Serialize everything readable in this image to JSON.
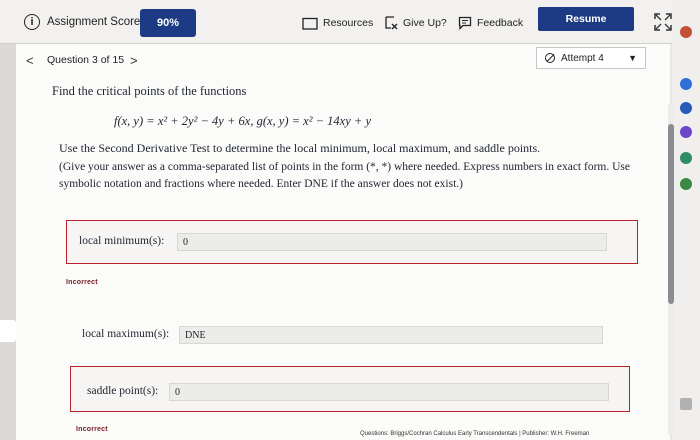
{
  "header": {
    "score_label": "Assignment Score:",
    "score_value": "90%",
    "resources_label": "Resources",
    "giveup_label": "Give Up?",
    "feedback_label": "Feedback",
    "resume_label": "Resume"
  },
  "nav": {
    "prev": "<",
    "counter": "Question 3 of 15",
    "next": ">",
    "attempt_label": "Attempt 4"
  },
  "question": {
    "prompt": "Find the critical points of the functions",
    "formula": "f(x, y) = x² + 2y² − 4y + 6x,     g(x, y) = x² − 14xy + y",
    "instruction": "Use the Second Derivative Test to determine the local minimum, local maximum, and saddle points.",
    "note": "(Give your answer as a comma-separated list of points in the form (*, *) where needed. Express numbers in exact form. Use symbolic notation and fractions where needed. Enter DNE if the answer does not exist.)"
  },
  "answers": {
    "local_min": {
      "label": "local minimum(s):",
      "value": "0",
      "status": "Incorrect"
    },
    "local_max": {
      "label": "local maximum(s):",
      "value": "DNE"
    },
    "saddle": {
      "label": "saddle point(s):",
      "value": "0",
      "status": "Incorrect"
    }
  },
  "footer": {
    "text": "Questions: Briggs/Cochran Calculus Early Transcendentals | Publisher: W.H. Freeman"
  },
  "colors": {
    "primary": "#1d3b84",
    "error": "#b8202a"
  }
}
